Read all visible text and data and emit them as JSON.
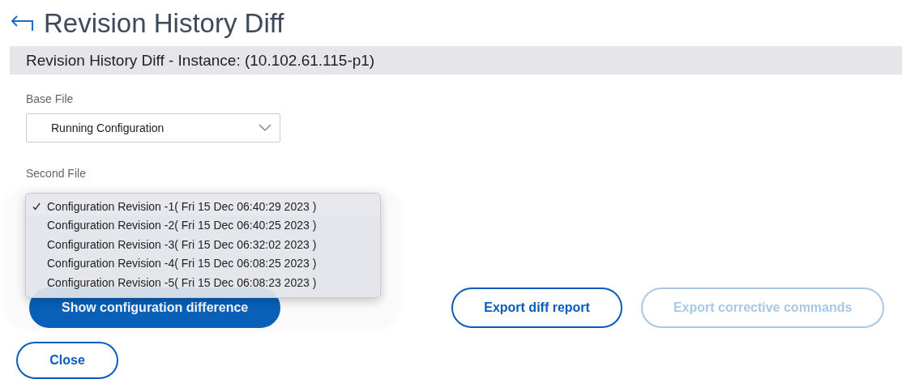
{
  "header": {
    "title": "Revision History Diff"
  },
  "panel": {
    "title": "Revision History Diff - Instance: (10.102.61.115-p1)"
  },
  "base_file": {
    "label": "Base File",
    "value": "Running Configuration"
  },
  "second_file": {
    "label": "Second File",
    "options": [
      {
        "label": "Configuration Revision -1( Fri 15 Dec 06:40:29 2023 )",
        "selected": true
      },
      {
        "label": "Configuration Revision -2( Fri 15 Dec 06:40:25 2023 )",
        "selected": false
      },
      {
        "label": "Configuration Revision -3( Fri 15 Dec 06:32:02 2023 )",
        "selected": false
      },
      {
        "label": "Configuration Revision -4( Fri 15 Dec 06:08:25 2023 )",
        "selected": false
      },
      {
        "label": "Configuration Revision -5( Fri 15 Dec 06:08:23 2023 )",
        "selected": false
      }
    ]
  },
  "actions": [
    {
      "label": "Show configuration difference",
      "kind": "primary",
      "disabled": false
    },
    {
      "label": "Export diff report",
      "kind": "outline",
      "disabled": false
    },
    {
      "label": "Export corrective commands",
      "kind": "outline",
      "disabled": true
    }
  ],
  "close": {
    "label": "Close"
  }
}
